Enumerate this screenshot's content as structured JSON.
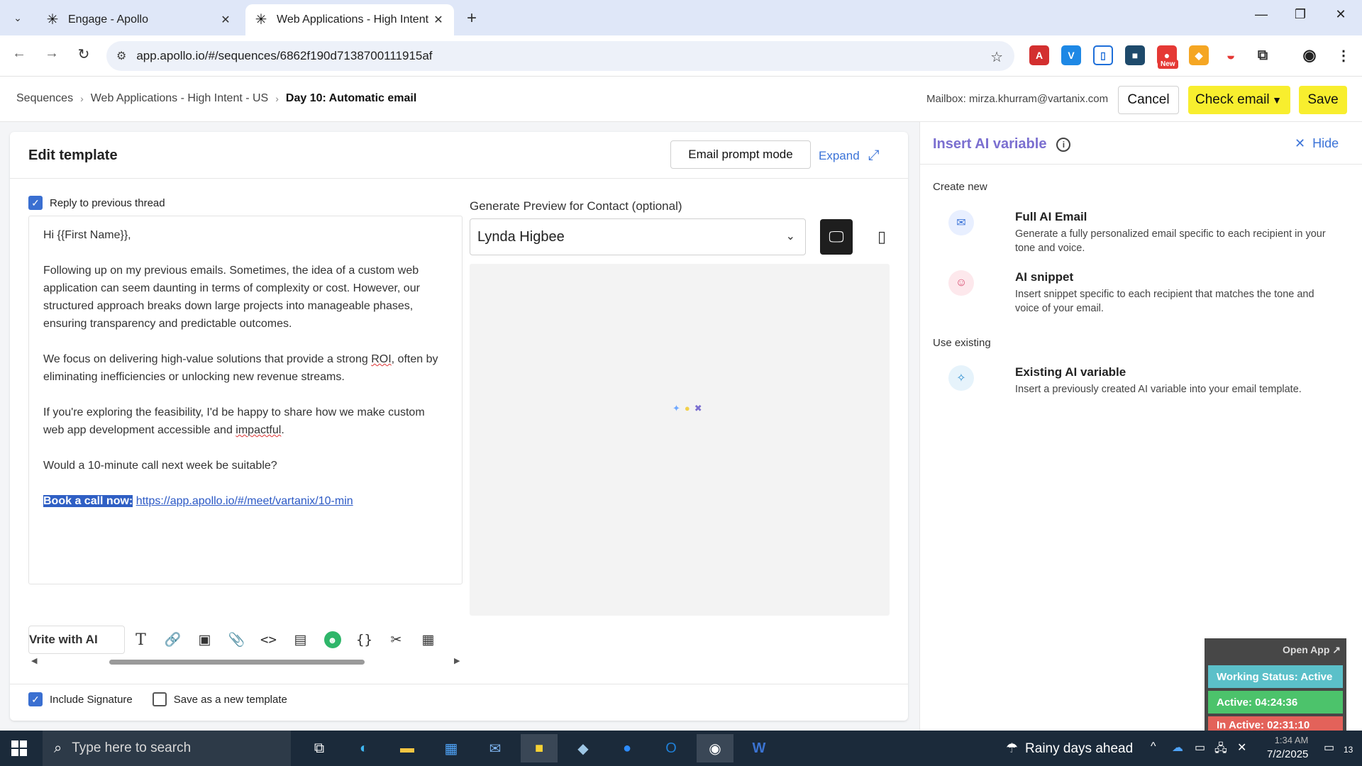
{
  "browser": {
    "tabs": [
      {
        "title": "Engage - Apollo",
        "active": false
      },
      {
        "title": "Web Applications - High Intent",
        "active": true
      }
    ],
    "url": "app.apollo.io/#/sequences/6862f190d7138700111915af",
    "ext_new_badge": "New"
  },
  "header": {
    "breadcrumbs": [
      "Sequences",
      "Web Applications - High Intent - US",
      "Day 10: Automatic email"
    ],
    "mailbox": "Mailbox: mirza.khurram@vartanix.com",
    "cancel_label": "Cancel",
    "check_email_label": "Check email",
    "save_label": "Save"
  },
  "editor": {
    "title": "Edit template",
    "prompt_mode_label": "Email prompt mode",
    "expand_label": "Expand",
    "reply_label": "Reply to previous thread",
    "reply_checked": true,
    "greeting": "Hi {{First Name}},",
    "p1": "Following up on my previous emails. Sometimes, the idea of a custom web application can seem daunting in terms of complexity or cost. However, our structured approach breaks down large projects into manageable phases, ensuring transparency and predictable outcomes.",
    "p2_a": "We focus on delivering high-value solutions that provide a strong ",
    "p2_roi": "ROI",
    "p2_b": ", often by eliminating inefficiencies or unlocking new revenue streams.",
    "p3_a": "If you're exploring the feasibility, I'd be happy to share how we make custom web app development accessible and ",
    "p3_impact": "impactful",
    "p3_b": ".",
    "p4": "Would a 10-minute call next week be suitable?",
    "cta_label": "Book a call now:",
    "cta_link": "https://app.apollo.io/#/meet/vartanix/10-min",
    "write_ai_label": "Vrite with AI",
    "include_signature_label": "Include Signature",
    "include_signature_checked": true,
    "save_template_label": "Save as a new template",
    "save_template_checked": false
  },
  "preview": {
    "label": "Generate Preview for Contact (optional)",
    "contact": "Lynda Higbee"
  },
  "ai_panel": {
    "title": "Insert AI variable",
    "hide_label": "Hide",
    "create_new_label": "Create new",
    "use_existing_label": "Use existing",
    "options": [
      {
        "title": "Full AI Email",
        "desc": "Generate a fully personalized email specific to each recipient in your tone and voice."
      },
      {
        "title": "AI snippet",
        "desc": "Insert snippet specific to each recipient that matches the tone and voice of your email."
      },
      {
        "title": "Existing AI variable",
        "desc": "Insert a previously created AI variable into your email template."
      }
    ]
  },
  "widget": {
    "open_app": "Open App ↗",
    "working_status": "Working Status: Active",
    "active": "Active: 04:24:36",
    "inactive": "In Active: 02:31:10"
  },
  "taskbar": {
    "search_placeholder": "Type here to search",
    "weather": "Rainy days ahead",
    "time": "1:34 AM",
    "date": "7/2/2025",
    "notif_count": "13"
  },
  "colors": {
    "accent_yellow": "#f8ee2e",
    "link_blue": "#3c74d8",
    "ai_purple": "#7b6fd0",
    "widget_cyan": "#5bc0c9",
    "widget_green": "#4cc36b",
    "widget_red": "#e3625a"
  }
}
